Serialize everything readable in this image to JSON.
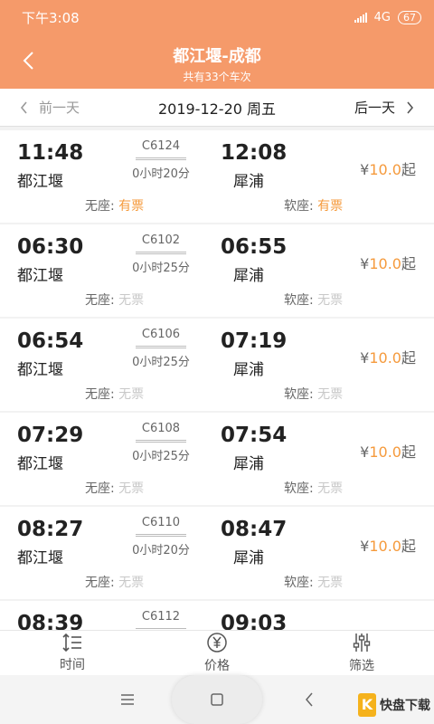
{
  "status_bar": {
    "time": "下午3:08",
    "network": "4G",
    "battery": "67"
  },
  "header": {
    "title": "都江堰-成都",
    "subtitle": "共有33个车次"
  },
  "date_bar": {
    "prev_label": "前一天",
    "date": "2019-12-20 周五",
    "next_label": "后一天"
  },
  "colors": {
    "accent": "#f59a6a",
    "price": "#f59a3c",
    "unavailable": "#c8c8c8"
  },
  "seat_labels": {
    "no_seat": "无座:",
    "soft_seat": "软座:"
  },
  "trains": [
    {
      "train_no": "C6124",
      "depart_time": "11:48",
      "arrive_time": "12:08",
      "from": "都江堰",
      "to": "犀浦",
      "duration": "0小时20分",
      "price_prefix": "¥",
      "price": "10.0",
      "price_suffix": "起",
      "no_seat_status": "有票",
      "soft_seat_status": "有票"
    },
    {
      "train_no": "C6102",
      "depart_time": "06:30",
      "arrive_time": "06:55",
      "from": "都江堰",
      "to": "犀浦",
      "duration": "0小时25分",
      "price_prefix": "¥",
      "price": "10.0",
      "price_suffix": "起",
      "no_seat_status": "无票",
      "soft_seat_status": "无票"
    },
    {
      "train_no": "C6106",
      "depart_time": "06:54",
      "arrive_time": "07:19",
      "from": "都江堰",
      "to": "犀浦",
      "duration": "0小时25分",
      "price_prefix": "¥",
      "price": "10.0",
      "price_suffix": "起",
      "no_seat_status": "无票",
      "soft_seat_status": "无票"
    },
    {
      "train_no": "C6108",
      "depart_time": "07:29",
      "arrive_time": "07:54",
      "from": "都江堰",
      "to": "犀浦",
      "duration": "0小时25分",
      "price_prefix": "¥",
      "price": "10.0",
      "price_suffix": "起",
      "no_seat_status": "无票",
      "soft_seat_status": "无票"
    },
    {
      "train_no": "C6110",
      "depart_time": "08:27",
      "arrive_time": "08:47",
      "from": "都江堰",
      "to": "犀浦",
      "duration": "0小时20分",
      "price_prefix": "¥",
      "price": "10.0",
      "price_suffix": "起",
      "no_seat_status": "无票",
      "soft_seat_status": "无票"
    },
    {
      "train_no": "C6112",
      "depart_time": "08:39",
      "arrive_time": "09:03",
      "from": "",
      "to": "",
      "duration": "",
      "price_prefix": "",
      "price": "",
      "price_suffix": "",
      "no_seat_status": "",
      "soft_seat_status": ""
    }
  ],
  "tabs": [
    {
      "label": "时间",
      "icon": "sort-time-icon"
    },
    {
      "label": "价格",
      "icon": "yen-circle-icon"
    },
    {
      "label": "筛选",
      "icon": "filter-sliders-icon"
    }
  ],
  "watermark": {
    "logo_char": "K",
    "logo_text": "快盘下载"
  }
}
